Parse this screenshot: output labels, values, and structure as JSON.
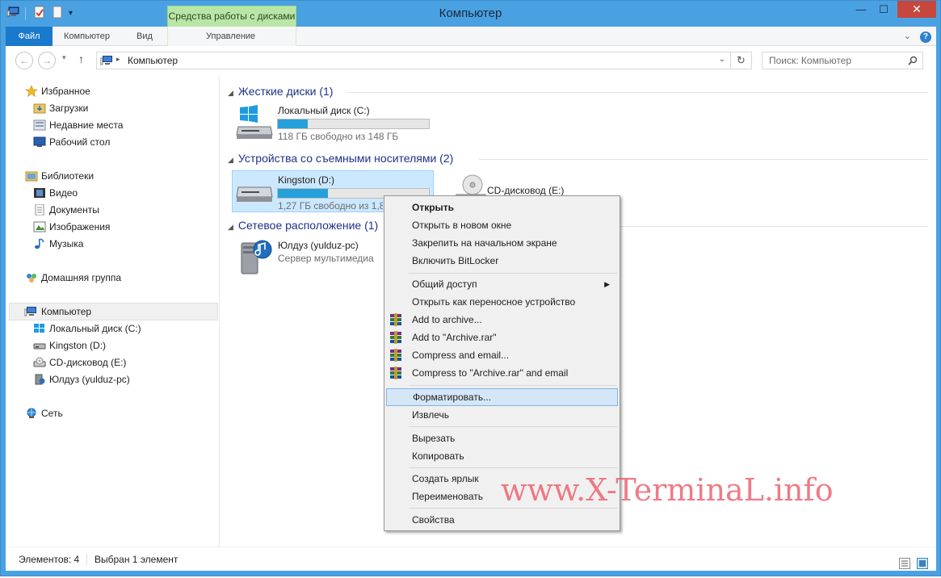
{
  "window": {
    "title": "Компьютер",
    "minimize": "—",
    "maximize": "☐",
    "close": "✕"
  },
  "ribbon": {
    "context_group": "Средства работы с дисками",
    "tabs": [
      "Файл",
      "Компьютер",
      "Вид",
      "Управление"
    ]
  },
  "address": {
    "path": "Компьютер",
    "search_placeholder": "Поиск: Компьютер"
  },
  "sidebar": {
    "favorites": "Избранное",
    "favorites_items": [
      "Загрузки",
      "Недавние места",
      "Рабочий стол"
    ],
    "libraries": "Библиотеки",
    "libraries_items": [
      "Видео",
      "Документы",
      "Изображения",
      "Музыка"
    ],
    "homegroup": "Домашняя группа",
    "computer": "Компьютер",
    "computer_items": [
      "Локальный диск (C:)",
      "Kingston (D:)",
      "CD-дисковод (E:)",
      "Юлдуз (yulduz-pc)"
    ],
    "network": "Сеть"
  },
  "main": {
    "groups": [
      "Жесткие диски (1)",
      "Устройства со съемными носителями (2)",
      "Сетевое расположение (1)"
    ],
    "drive_c": {
      "name": "Локальный диск (C:)",
      "free": "118 ГБ свободно из 148 ГБ",
      "used_fraction": 0.2
    },
    "drive_d": {
      "name": "Kingston (D:)",
      "free": "1,27 ГБ свободно из 1,89 ГБ",
      "used_fraction": 0.33
    },
    "drive_e": {
      "name": "CD-дисковод (E:)"
    },
    "media": {
      "name": "Юлдуз (yulduz-pc)",
      "type": "Сервер мультимедиа"
    }
  },
  "status": {
    "items": "Элементов: 4",
    "selected": "Выбран 1 элемент"
  },
  "context_menu": {
    "items": [
      "Открыть",
      "Открыть в новом окне",
      "Закрепить на начальном экране",
      "Включить BitLocker",
      "Общий доступ",
      "Открыть как переносное устройство",
      "Add to archive...",
      "Add to \"Archive.rar\"",
      "Compress and email...",
      "Compress to \"Archive.rar\" and email",
      "Форматировать...",
      "Извлечь",
      "Вырезать",
      "Копировать",
      "Создать ярлык",
      "Переименовать",
      "Свойства"
    ]
  },
  "watermark": "www.X-TerminaL.info",
  "colors": {
    "title_bar": "#4aa1e2",
    "file_tab": "#1979ca",
    "context_group": "#b9e6a7",
    "close": "#c7463d",
    "progress": "#26a0da",
    "group_heading": "#1e3287"
  }
}
